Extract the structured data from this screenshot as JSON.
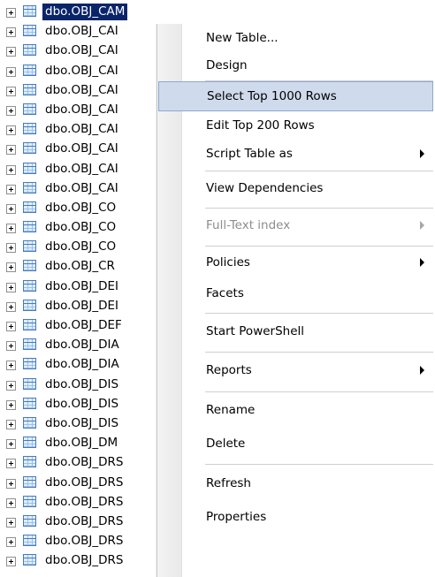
{
  "tree": {
    "items": [
      {
        "label": "dbo.OBJ_CAM"
      },
      {
        "label": "dbo.OBJ_CAI"
      },
      {
        "label": "dbo.OBJ_CAI"
      },
      {
        "label": "dbo.OBJ_CAI"
      },
      {
        "label": "dbo.OBJ_CAI"
      },
      {
        "label": "dbo.OBJ_CAI"
      },
      {
        "label": "dbo.OBJ_CAI"
      },
      {
        "label": "dbo.OBJ_CAI"
      },
      {
        "label": "dbo.OBJ_CAI"
      },
      {
        "label": "dbo.OBJ_CAI"
      },
      {
        "label": "dbo.OBJ_CO"
      },
      {
        "label": "dbo.OBJ_CO"
      },
      {
        "label": "dbo.OBJ_CO"
      },
      {
        "label": "dbo.OBJ_CR"
      },
      {
        "label": "dbo.OBJ_DEI"
      },
      {
        "label": "dbo.OBJ_DEI"
      },
      {
        "label": "dbo.OBJ_DEF"
      },
      {
        "label": "dbo.OBJ_DIA"
      },
      {
        "label": "dbo.OBJ_DIA"
      },
      {
        "label": "dbo.OBJ_DIS"
      },
      {
        "label": "dbo.OBJ_DIS"
      },
      {
        "label": "dbo.OBJ_DIS"
      },
      {
        "label": "dbo.OBJ_DM"
      },
      {
        "label": "dbo.OBJ_DRS"
      },
      {
        "label": "dbo.OBJ_DRS"
      },
      {
        "label": "dbo.OBJ_DRS"
      },
      {
        "label": "dbo.OBJ_DRS"
      },
      {
        "label": "dbo.OBJ_DRS"
      },
      {
        "label": "dbo.OBJ_DRS"
      }
    ]
  },
  "context_menu": {
    "items": [
      {
        "label": "New Table..."
      },
      {
        "label": "Design"
      },
      {
        "label": "Select Top 1000 Rows"
      },
      {
        "label": "Edit Top 200 Rows"
      },
      {
        "label": "Script Table as"
      },
      {
        "label": "View Dependencies"
      },
      {
        "label": "Full-Text index"
      },
      {
        "label": "Policies"
      },
      {
        "label": "Facets"
      },
      {
        "label": "Start PowerShell"
      },
      {
        "label": "Reports"
      },
      {
        "label": "Rename"
      },
      {
        "label": "Delete"
      },
      {
        "label": "Refresh"
      },
      {
        "label": "Properties"
      }
    ]
  }
}
